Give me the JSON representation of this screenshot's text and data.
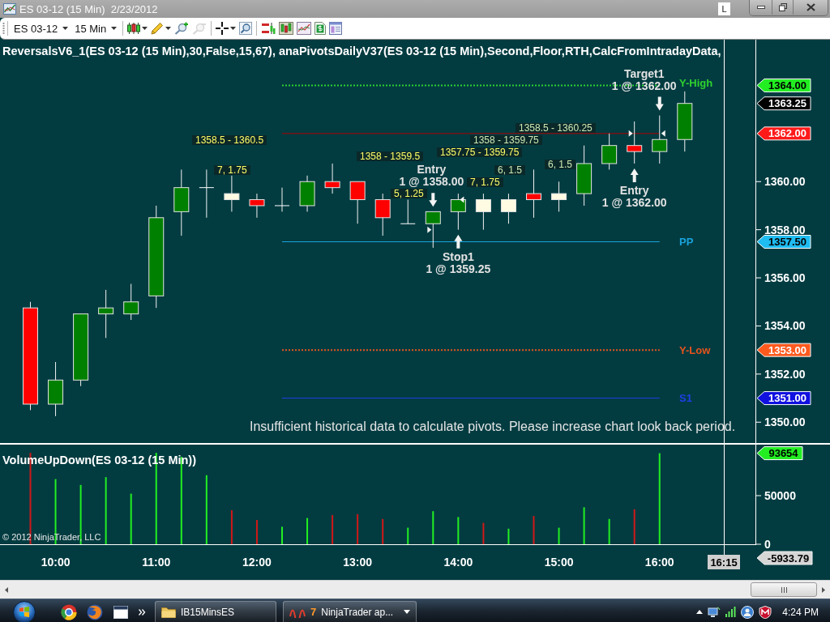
{
  "window": {
    "title": "ES 03-12 (15 Min)  2/23/2012",
    "badge": "L"
  },
  "toolbar": {
    "instrument": "ES 03-12",
    "interval": "15 Min",
    "zoom_out": {
      "disabled": true
    }
  },
  "price_pane": {
    "indicator_label": "ReversalsV6_1(ES 03-12 (15 Min),30,False,15,67), anaPivotsDailyV37(ES 03-12 (15 Min),Second,Floor,RTH,CalcFromIntradayData,",
    "chart_data": [
      {
        "type": "candlestick",
        "ohlc": [
          [
            1354.75,
            1355,
            1350.5,
            1350.75
          ],
          [
            1350.75,
            1352.5,
            1350.25,
            1351.75
          ],
          [
            1351.75,
            1354.5,
            1351.5,
            1354.5
          ],
          [
            1354.5,
            1355.5,
            1353.5,
            1354.75
          ],
          [
            1354.5,
            1355.75,
            1354.25,
            1355
          ],
          [
            1355.25,
            1359,
            1354.75,
            1358.5
          ],
          [
            1358.75,
            1360.5,
            1357.75,
            1359.75
          ],
          [
            1359.75,
            1360.5,
            1358.5,
            1359.75
          ],
          [
            1359.25,
            1360.25,
            1358.75,
            1359.5
          ],
          [
            1359.25,
            1359.5,
            1358.5,
            1359
          ],
          [
            1359,
            1359.75,
            1358.75,
            1359
          ],
          [
            1359,
            1360.25,
            1358.75,
            1360
          ],
          [
            1360,
            1360.75,
            1359.5,
            1359.75
          ],
          [
            1360,
            1360,
            1358.25,
            1359.25
          ],
          [
            1359.25,
            1359.5,
            1357.75,
            1358.5
          ],
          [
            1358.25,
            1359.25,
            1358.25,
            1358.25
          ],
          [
            1358.25,
            1358.75,
            1357.25,
            1358.75
          ],
          [
            1358.75,
            1359.5,
            1358,
            1359.25
          ],
          [
            1358.75,
            1359.5,
            1358,
            1359.25
          ],
          [
            1358.75,
            1359.5,
            1358.25,
            1359.25
          ],
          [
            1359.5,
            1360.5,
            1358.5,
            1359.25
          ],
          [
            1359.25,
            1360,
            1358.75,
            1359.5
          ],
          [
            1359.5,
            1361.5,
            1359,
            1360.75
          ],
          [
            1360.75,
            1362,
            1360.5,
            1361.5
          ],
          [
            1361.5,
            1362.5,
            1360.75,
            1361.25
          ],
          [
            1361.25,
            1362.75,
            1360.75,
            1361.75
          ],
          [
            1361.75,
            1363.75,
            1361.25,
            1363.25
          ]
        ],
        "colors": [
          "#ff0000",
          "#008000",
          "#008000",
          "#008000",
          "#008000",
          "#008000",
          "#008000",
          "#ffffff",
          "#fffbe3",
          "#ff0000",
          "#ffffff",
          "#008000",
          "#ff0000",
          "#ff0000",
          "#ff0000",
          "#ffffff",
          "#008000",
          "#008000",
          "#fffbe3",
          "#fffbe3",
          "#ff0000",
          "#fffbe3",
          "#008000",
          "#008000",
          "#ff0000",
          "#008000",
          "#008000"
        ],
        "ylim": [
          1349.1,
          1365.9
        ],
        "yticks": [
          {
            "value": 1350,
            "label": "1350.00"
          },
          {
            "value": 1352,
            "label": "1352.00"
          },
          {
            "value": 1354,
            "label": "1354.00"
          },
          {
            "value": 1356,
            "label": "1356.00"
          },
          {
            "value": 1358,
            "label": "1358.00"
          },
          {
            "value": 1360,
            "label": "1360.00"
          }
        ],
        "ref_lines": [
          {
            "axis": "y",
            "value": 1364,
            "label": "Y-High",
            "color": "#2ed12e",
            "line_style": "dotted"
          },
          {
            "axis": "y",
            "value": 1362,
            "color": "#b00000",
            "line_style": "solid"
          },
          {
            "axis": "y",
            "value": 1357.5,
            "label": "PP",
            "color": "#1aa3dc",
            "line_style": "solid"
          },
          {
            "axis": "y",
            "value": 1353,
            "label": "Y-Low",
            "color": "#e5531c",
            "line_style": "dotted"
          },
          {
            "axis": "y",
            "value": 1351,
            "label": "S1",
            "color": "#1f3fe6",
            "line_style": "solid"
          }
        ]
      }
    ],
    "bar_labels": [
      {
        "text": "1358.5 - 1360.25",
        "color": "#cce8b4"
      },
      {
        "text": "1358.5 - 1360.5",
        "color": "#ffff66"
      },
      {
        "text": "1358 - 1359.75",
        "color": "#cce8b4"
      },
      {
        "text": "1357.75 - 1359.75",
        "color": "#ffff66"
      },
      {
        "text": "1358 - 1359.5",
        "color": "#ffff66"
      },
      {
        "text": "6, 1.5",
        "color": "#cce8b4"
      },
      {
        "text": "7, 1.75",
        "color": "#ffff66"
      },
      {
        "text": "6, 1.5",
        "color": "#cce8b4"
      },
      {
        "text": "7, 1.75",
        "color": "#ffff66"
      },
      {
        "text": "5, 1.25",
        "color": "#ffff66"
      }
    ],
    "executions": [
      {
        "kind": "exit",
        "buy": false,
        "name": "Target1",
        "detail": "1 @ 1362.00"
      },
      {
        "kind": "entry",
        "buy": false,
        "name": "Entry",
        "detail": "1 @ 1358.00"
      },
      {
        "kind": "entry",
        "buy": true,
        "name": "Entry",
        "detail": "1 @ 1362.00"
      },
      {
        "kind": "exit",
        "buy": true,
        "name": "Stop1",
        "detail": "1 @ 1359.25"
      }
    ],
    "price_tags": [
      {
        "text": "1364.00",
        "color": "#22ee22"
      },
      {
        "text": "1363.25",
        "color": "#000000"
      },
      {
        "text": "1362.00",
        "color": "#ff1a1a"
      },
      {
        "text": "1357.50",
        "color": "#1ebcf0"
      },
      {
        "text": "1353.00",
        "color": "#ff5a1e"
      },
      {
        "text": "1351.00",
        "color": "#1010e0"
      }
    ],
    "message": "Insufficient historical data to calculate pivots. Please increase chart look back period."
  },
  "volume_pane": {
    "title": "VolumeUpDown(ES 03-12 (15 Min))",
    "chart_data": [
      {
        "type": "bar",
        "categories": [
          null,
          "10:00",
          null,
          null,
          null,
          "11:00",
          null,
          null,
          null,
          "12:00",
          null,
          null,
          null,
          "13:00",
          null,
          null,
          null,
          "14:00",
          null,
          null,
          null,
          "15:00",
          null,
          null,
          null,
          "16:00",
          null
        ],
        "values": [
          94000,
          67000,
          61000,
          69000,
          52000,
          94000,
          90000,
          71000,
          35000,
          25000,
          18000,
          27000,
          30000,
          31000,
          26000,
          17000,
          34000,
          28000,
          22000,
          16000,
          29000,
          17000,
          38000,
          26000,
          36000,
          93654,
          null
        ],
        "colors": [
          "#d01818",
          "#22ee22",
          "#22ee22",
          "#22ee22",
          "#22ee22",
          "#22ee22",
          "#22ee22",
          "#22ee22",
          "#d01818",
          "#d01818",
          "#22ee22",
          "#22ee22",
          "#d01818",
          "#d01818",
          "#d01818",
          "#22ee22",
          "#22ee22",
          "#22ee22",
          "#d01818",
          "#22ee22",
          "#d01818",
          "#22ee22",
          "#22ee22",
          "#22ee22",
          "#d01818",
          "#22ee22",
          null
        ],
        "ylim": [
          0,
          103300
        ],
        "yticks": [
          0,
          50000
        ]
      }
    ],
    "value_tag": "93654",
    "copyright": "© 2012 NinjaTrader, LLC"
  },
  "time_axis": {
    "cursor_time": "16:15",
    "cursor_value": "-5933.79"
  },
  "taskbar": {
    "tasks": [
      {
        "kind": "folder",
        "label": "IB15MinsES"
      },
      {
        "kind": "app",
        "count": "7",
        "label": "NinjaTrader ap..."
      }
    ],
    "clock": "4:24 PM"
  }
}
